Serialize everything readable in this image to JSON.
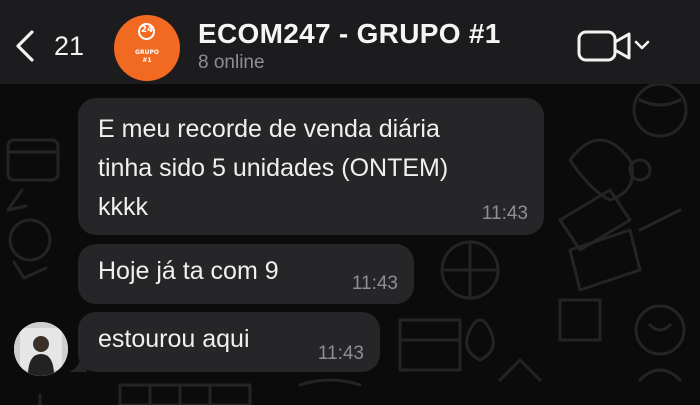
{
  "header": {
    "back_count": "21",
    "title": "ECOM247 - GRUPO #1",
    "subtitle": "8 online",
    "avatar_logo_number": "24",
    "avatar_logo_text_1": "GRUPO",
    "avatar_logo_text_2": "#1",
    "avatar_color": "#f26a21"
  },
  "messages": [
    {
      "lines": [
        "E meu recorde de venda diária",
        "tinha sido 5 unidades (ONTEM)",
        "kkkk"
      ],
      "time": "11:43"
    },
    {
      "text": "Hoje já ta com 9",
      "time": "11:43"
    },
    {
      "text": "estourou aqui",
      "time": "11:43"
    }
  ],
  "icons": {
    "back": "chevron-left-icon",
    "video": "video-camera-icon",
    "dropdown": "chevron-down-icon"
  },
  "colors": {
    "header_bg": "#1c1c1e",
    "chat_bg": "#0b0b0b",
    "bubble_bg": "#262628",
    "secondary_text": "#8e8e93"
  }
}
